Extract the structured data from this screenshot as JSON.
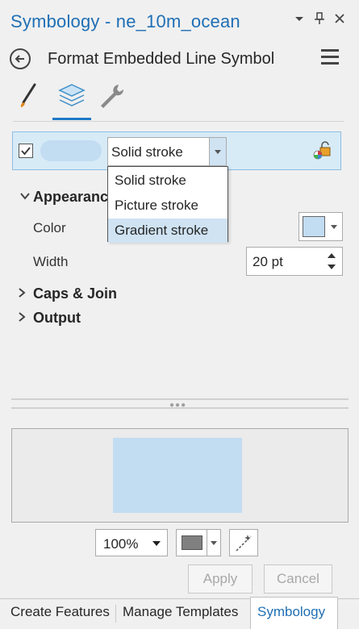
{
  "window": {
    "title": "Symbology - ne_10m_ocean",
    "controls": [
      "dropdown-icon",
      "pin-icon",
      "close-icon"
    ]
  },
  "header": {
    "title": "Format Embedded Line Symbol",
    "back_icon": "back-arrow-icon",
    "menu_icon": "hamburger-menu-icon"
  },
  "tabs": [
    {
      "icon": "brush-icon",
      "active": false
    },
    {
      "icon": "layers-icon",
      "active": true
    },
    {
      "icon": "wrench-icon",
      "active": false
    }
  ],
  "layer": {
    "checked": true,
    "swatch_color": "#c2dcf2",
    "stroke_type": "Solid stroke",
    "lock_icon": "lock-color-icon"
  },
  "stroke_dropdown": {
    "options": [
      "Solid stroke",
      "Picture stroke",
      "Gradient stroke"
    ],
    "highlighted": "Gradient stroke"
  },
  "appearance": {
    "heading": "Appearance",
    "color_label": "Color",
    "color_value": "#c2dcf2",
    "width_label": "Width",
    "width_value": "20 pt"
  },
  "sections": {
    "caps_join": "Caps & Join",
    "output": "Output"
  },
  "preview": {
    "fill_color": "#c2dcf2",
    "background": "#ebebeb"
  },
  "preview_controls": {
    "zoom": "100%",
    "background_swatch": "#808080"
  },
  "buttons": {
    "apply": "Apply",
    "cancel": "Cancel"
  },
  "bottom_tabs": {
    "create_features": "Create Features",
    "manage_templates": "Manage Templates",
    "symbology": "Symbology"
  },
  "colors": {
    "accent": "#1f6fb5",
    "selection": "#cfe3f3"
  }
}
